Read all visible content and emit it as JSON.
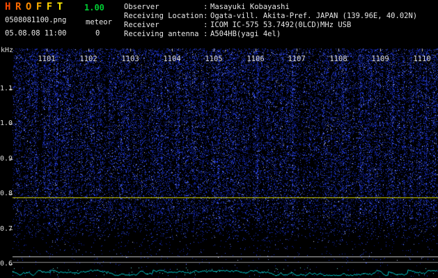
{
  "header": {
    "title_letters": [
      {
        "char": "H",
        "color": "#ff4a00"
      },
      {
        "char": "R",
        "color": "#ff6a00"
      },
      {
        "char": "O",
        "color": "#ff8d00"
      },
      {
        "char": "F",
        "color": "#ffb300"
      },
      {
        "char": "F",
        "color": "#ffd400"
      },
      {
        "char": "T",
        "color": "#ffee00"
      }
    ],
    "version": "1.00",
    "version_color": "#00cc33",
    "filename": "0508081100.png",
    "meteor_label": "meteor",
    "meteor_count": "0",
    "datetime": "05.08.08 11:00",
    "info_rows": [
      {
        "label": "Observer",
        "sep": ":",
        "value": "Masayuki Kobayashi"
      },
      {
        "label": "Receiving Location",
        "sep": ":",
        "value": "Ogata-vill. Akita-Pref. JAPAN (139.96E, 40.02N)"
      },
      {
        "label": "Receiver",
        "sep": ":",
        "value": "ICOM IC-575 53.7492(0LCD)MHz USB"
      },
      {
        "label": "Receiving antenna",
        "sep": ":",
        "value": "A504HB(yagi 4el)"
      }
    ]
  },
  "spectrogram": {
    "unit_label": "kHz",
    "freq_tick_labels": [
      "1.1",
      "1.0",
      "0.9",
      "0.8",
      "0.7",
      "0.6"
    ],
    "time_tick_labels": [
      "1101",
      "1102",
      "1103",
      "1104",
      "1105",
      "1106",
      "1107",
      "1108",
      "1109",
      "1110"
    ],
    "colors": {
      "background": "#000000",
      "noise_blue": "#2a3fe0",
      "marker_line": "#d6d600",
      "grid_line_bright": "#c8c8c8",
      "grid_line_dim": "#909090",
      "noise_trace": "#00c8c8",
      "axis_text": "#dcdcdc"
    }
  }
}
